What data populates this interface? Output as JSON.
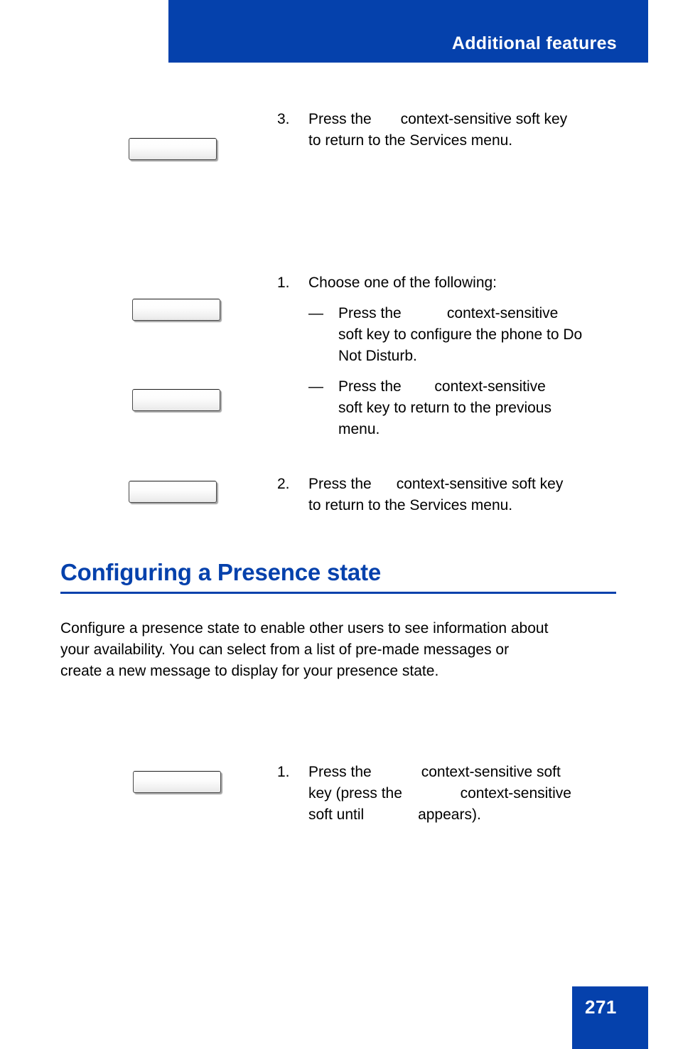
{
  "header": {
    "title": "Additional features",
    "banner_color": "#0541AC"
  },
  "steps": [
    {
      "number": "3.",
      "lines": [
        "Press the",
        "context-sensitive soft key",
        "to return to the Services menu."
      ],
      "line1_prefix": "Press the",
      "line1_suffix": "context-sensitive soft key",
      "line2": "to return to the Services menu."
    },
    {
      "number": "1.",
      "intro": "Choose one of the following:",
      "subitems": [
        {
          "dash": "—",
          "prefix": "Press the",
          "suffix": "context-sensitive",
          "rest1": "soft key to configure the phone to Do",
          "rest2": "Not Disturb."
        },
        {
          "dash": "—",
          "prefix": "Press the",
          "suffix": "context-sensitive",
          "rest1": "soft key to return to the previous",
          "rest2": "menu."
        }
      ]
    },
    {
      "number": "2.",
      "line1_prefix": "Press the",
      "line1_suffix": "context-sensitive soft key",
      "line2": "to return to the Services menu."
    },
    {
      "number": "1.",
      "line1_prefix": "Press the",
      "line1_suffix": "context-sensitive soft",
      "line2_prefix": "key (press the",
      "line2_suffix": "context-sensitive",
      "line3_prefix": "soft until",
      "line3_suffix": "appears)."
    }
  ],
  "section": {
    "heading": "Configuring a Presence state",
    "heading_color": "#0541AC",
    "paragraph_line1": "Configure a presence state to enable other users to see information about",
    "paragraph_line2": "your availability. You can select from a list of pre-made messages or",
    "paragraph_line3": "create a new message to display for your presence state."
  },
  "softkeys": [
    {
      "name": "softkey-button-1",
      "label": ""
    },
    {
      "name": "softkey-button-2",
      "label": ""
    },
    {
      "name": "softkey-button-3",
      "label": ""
    },
    {
      "name": "softkey-button-4",
      "label": ""
    },
    {
      "name": "softkey-button-5",
      "label": ""
    }
  ],
  "footer": {
    "page_number": "271",
    "block_color": "#0541AC"
  }
}
